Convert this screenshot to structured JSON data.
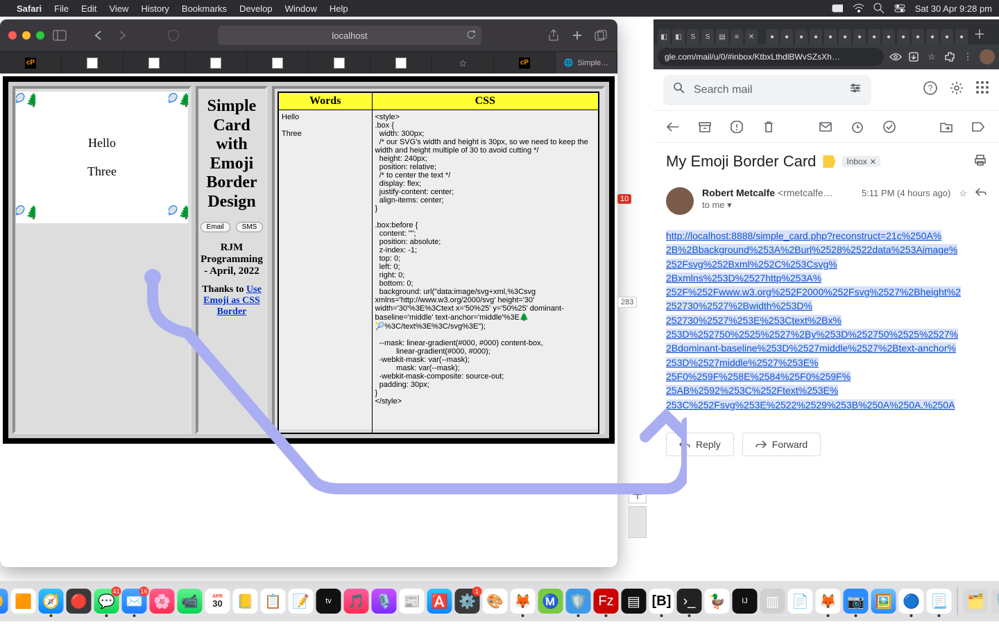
{
  "menubar": {
    "app": "Safari",
    "items": [
      "File",
      "Edit",
      "View",
      "History",
      "Bookmarks",
      "Develop",
      "Window",
      "Help"
    ],
    "clock": "Sat 30 Apr  9:28 pm"
  },
  "safari": {
    "url_label": "localhost",
    "tab_label": "Simple…",
    "card": {
      "line1": "Hello",
      "line2": "Three"
    },
    "mid": {
      "title": "Simple Card with Emoji Border Design",
      "btn_email": "Email",
      "btn_sms": "SMS",
      "byline": "RJM Programming - April, 2022",
      "thanks_pre": "Thanks to ",
      "thanks_link": "Use Emoji as CSS Border"
    },
    "table": {
      "h1": "Words",
      "h2": "CSS",
      "words": "Hello\n\nThree",
      "css": "<style>\n.box {\n  width: 300px;\n  /* our SVG's width and height is 30px, so we need to keep the width and height multiple of 30 to avoid cutting */\n  height: 240px;\n  position: relative;\n  /* to center the text */\n  display: flex;\n  justify-content: center;\n  align-items: center;\n}\n\n.box:before {\n  content: \"\";\n  position: absolute;\n  z-index: -1;\n  top: 0;\n  left: 0;\n  right: 0;\n  bottom: 0;\n  background: url(\"data:image/svg+xml,%3Csvg xmlns='http://www.w3.org/2000/svg' height='30' width='30'%3E%3Ctext x='50%25' y='50%25' dominant-baseline='middle' text-anchor='middle'%3E🌲🎾%3C/text%3E%3C/svg%3E\");\n\n  --mask: linear-gradient(#000, #000) content-box,\n          linear-gradient(#000, #000);\n  -webkit-mask: var(--mask);\n          mask: var(--mask);\n  -webkit-mask-composite: source-out;\n  padding: 30px;\n}\n</style>"
    }
  },
  "chrome": {
    "addr": "gle.com/mail/u/0/#inbox/KtbxLthdlBWvSZsXh…",
    "badges": {
      "b1": "10",
      "b2": "283"
    }
  },
  "gmail": {
    "search_placeholder": "Search mail",
    "subject": "My Emoji Border Card",
    "inbox_chip": "Inbox",
    "from_name": "Robert Metcalfe",
    "from_addr": "<rmetcalfe…",
    "time": "5:11 PM (4 hours ago)",
    "to_line": "to me",
    "link_lines": [
      "http://localhost:8888/simple_card.php?reconstruct=21c%250A%",
      "2B%2Bbackground%253A%2Burl%2528%2522data%253Aimage%",
      "252Fsvg%252Bxml%252C%253Csvg%",
      "2Bxmlns%253D%2527http%253A%",
      "252F%252Fwww.w3.org%252F2000%252Fsvg%2527%2Bheight%2",
      "252730%2527%2Bwidth%253D%",
      "252730%2527%253E%253Ctext%2Bx%",
      "253D%252750%2525%2527%2By%253D%252750%2525%2527%",
      "2Bdominant-baseline%253D%2527middle%2527%2Btext-anchor%",
      "253D%2527middle%2527%253E%",
      "25F0%259F%258E%2584%25F0%259F%",
      "25AB%2592%253C%252Ftext%253E%",
      "253C%252Fsvg%253E%2522%2529%253B%250A%250A.%250A"
    ],
    "reply": "Reply",
    "forward": "Forward"
  },
  "dock": {
    "badges": {
      "msg": "41",
      "mail": "16",
      "cal_day": "30",
      "clock_sub": "APR"
    }
  }
}
